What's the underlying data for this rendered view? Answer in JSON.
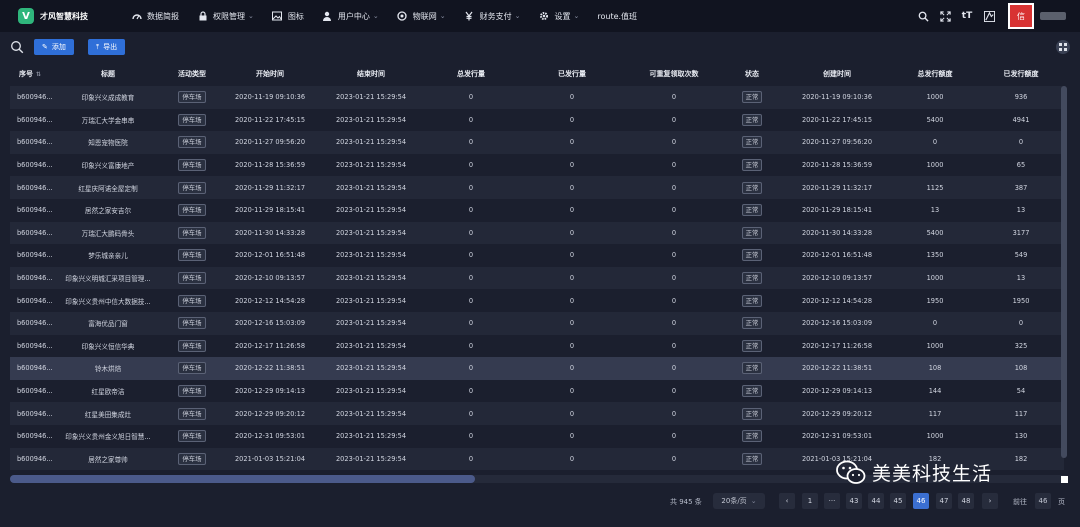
{
  "app": {
    "logo_letter": "V",
    "brand": "才风智慧科技"
  },
  "nav": [
    {
      "label": "数据简报",
      "icon": "dashboard-icon",
      "dropdown": false
    },
    {
      "label": "权限管理",
      "icon": "lock-icon",
      "dropdown": true
    },
    {
      "label": "图标",
      "icon": "image-icon",
      "dropdown": false
    },
    {
      "label": "用户中心",
      "icon": "user-icon",
      "dropdown": true
    },
    {
      "label": "物联网",
      "icon": "iot-icon",
      "dropdown": true
    },
    {
      "label": "财务支付",
      "icon": "yen-icon",
      "dropdown": true
    },
    {
      "label": "设置",
      "icon": "gear-icon",
      "dropdown": true
    },
    {
      "label": "route.值班",
      "icon": "",
      "dropdown": false
    }
  ],
  "topbar_right": {
    "font_size_icon": "tT",
    "avatar_text": "信"
  },
  "toolbar": {
    "add_label": "添加",
    "export_label": "导出"
  },
  "columns": [
    "序号",
    "标题",
    "活动类型",
    "开始时间",
    "结束时间",
    "总发行量",
    "已发行量",
    "可重复领取次数",
    "状态",
    "创建时间",
    "总发行额度",
    "已发行额度"
  ],
  "rows": [
    [
      "b600946...",
      "印象兴义成成教育",
      "停车场",
      "2020-11-19 09:10:36",
      "2023-01-21 15:29:54",
      "0",
      "0",
      "0",
      "正常",
      "2020-11-19 09:10:36",
      "1000",
      "936"
    ],
    [
      "b600946...",
      "万瑞汇大学金串串",
      "停车场",
      "2020-11-22 17:45:15",
      "2023-01-21 15:29:54",
      "0",
      "0",
      "0",
      "正常",
      "2020-11-22 17:45:15",
      "5400",
      "4941"
    ],
    [
      "b600946...",
      "知恩宠物医院",
      "停车场",
      "2020-11-27 09:56:20",
      "2023-01-21 15:29:54",
      "0",
      "0",
      "0",
      "正常",
      "2020-11-27 09:56:20",
      "0",
      "0"
    ],
    [
      "b600946...",
      "印象兴义富康地产",
      "停车场",
      "2020-11-28 15:36:59",
      "2023-01-21 15:29:54",
      "0",
      "0",
      "0",
      "正常",
      "2020-11-28 15:36:59",
      "1000",
      "65"
    ],
    [
      "b600946...",
      "红星庆阿诺全屋定制",
      "停车场",
      "2020-11-29 11:32:17",
      "2023-01-21 15:29:54",
      "0",
      "0",
      "0",
      "正常",
      "2020-11-29 11:32:17",
      "1125",
      "387"
    ],
    [
      "b600946...",
      "居然之家安吉尔",
      "停车场",
      "2020-11-29 18:15:41",
      "2023-01-21 15:29:54",
      "0",
      "0",
      "0",
      "正常",
      "2020-11-29 18:15:41",
      "13",
      "13"
    ],
    [
      "b600946...",
      "万瑞汇大鹏码骨头",
      "停车场",
      "2020-11-30 14:33:28",
      "2023-01-21 15:29:54",
      "0",
      "0",
      "0",
      "正常",
      "2020-11-30 14:33:28",
      "5400",
      "3177"
    ],
    [
      "b600946...",
      "梦乐城亲亲儿",
      "停车场",
      "2020-12-01 16:51:48",
      "2023-01-21 15:29:54",
      "0",
      "0",
      "0",
      "正常",
      "2020-12-01 16:51:48",
      "1350",
      "549"
    ],
    [
      "b600946...",
      "印象兴义明城汇采项目管理...",
      "停车场",
      "2020-12-10 09:13:57",
      "2023-01-21 15:29:54",
      "0",
      "0",
      "0",
      "正常",
      "2020-12-10 09:13:57",
      "1000",
      "13"
    ],
    [
      "b600946...",
      "印象兴义贵州中信大数据技...",
      "停车场",
      "2020-12-12 14:54:28",
      "2023-01-21 15:29:54",
      "0",
      "0",
      "0",
      "正常",
      "2020-12-12 14:54:28",
      "1950",
      "1950"
    ],
    [
      "b600946...",
      "富海优品门窗",
      "停车场",
      "2020-12-16 15:03:09",
      "2023-01-21 15:29:54",
      "0",
      "0",
      "0",
      "正常",
      "2020-12-16 15:03:09",
      "0",
      "0"
    ],
    [
      "b600946...",
      "印象兴义恒信华典",
      "停车场",
      "2020-12-17 11:26:58",
      "2023-01-21 15:29:54",
      "0",
      "0",
      "0",
      "正常",
      "2020-12-17 11:26:58",
      "1000",
      "325"
    ],
    [
      "b600946...",
      "铃木烘焙",
      "停车场",
      "2020-12-22 11:38:51",
      "2023-01-21 15:29:54",
      "0",
      "0",
      "0",
      "正常",
      "2020-12-22 11:38:51",
      "108",
      "108"
    ],
    [
      "b600946...",
      "红星欧帝洁",
      "停车场",
      "2020-12-29 09:14:13",
      "2023-01-21 15:29:54",
      "0",
      "0",
      "0",
      "正常",
      "2020-12-29 09:14:13",
      "144",
      "54"
    ],
    [
      "b600946...",
      "红星美田集成灶",
      "停车场",
      "2020-12-29 09:20:12",
      "2023-01-21 15:29:54",
      "0",
      "0",
      "0",
      "正常",
      "2020-12-29 09:20:12",
      "117",
      "117"
    ],
    [
      "b600946...",
      "印象兴义贵州金义旭日智慧...",
      "停车场",
      "2020-12-31 09:53:01",
      "2023-01-21 15:29:54",
      "0",
      "0",
      "0",
      "正常",
      "2020-12-31 09:53:01",
      "1000",
      "130"
    ],
    [
      "b600946...",
      "居然之家尊帅",
      "停车场",
      "2021-01-03 15:21:04",
      "2023-01-21 15:29:54",
      "0",
      "0",
      "0",
      "正常",
      "2021-01-03 15:21:04",
      "182",
      "182"
    ]
  ],
  "highlighted_row": 12,
  "pagination": {
    "total_text": "共 945 条",
    "page_size": "20条/页",
    "prev": "‹",
    "first": "1",
    "ellipsis": "···",
    "pages": [
      "43",
      "44",
      "45",
      "46",
      "47",
      "48"
    ],
    "current": "46",
    "next": "›",
    "goto_label": "前往",
    "goto_value": "46",
    "goto_suffix": "页"
  },
  "watermark": {
    "text": "美美科技生活"
  },
  "colors": {
    "accent": "#2f6fd8",
    "active_page": "#3b6fd1",
    "background": "#1b1f2e",
    "topbar": "#111420",
    "logo": "#2fb67c"
  }
}
